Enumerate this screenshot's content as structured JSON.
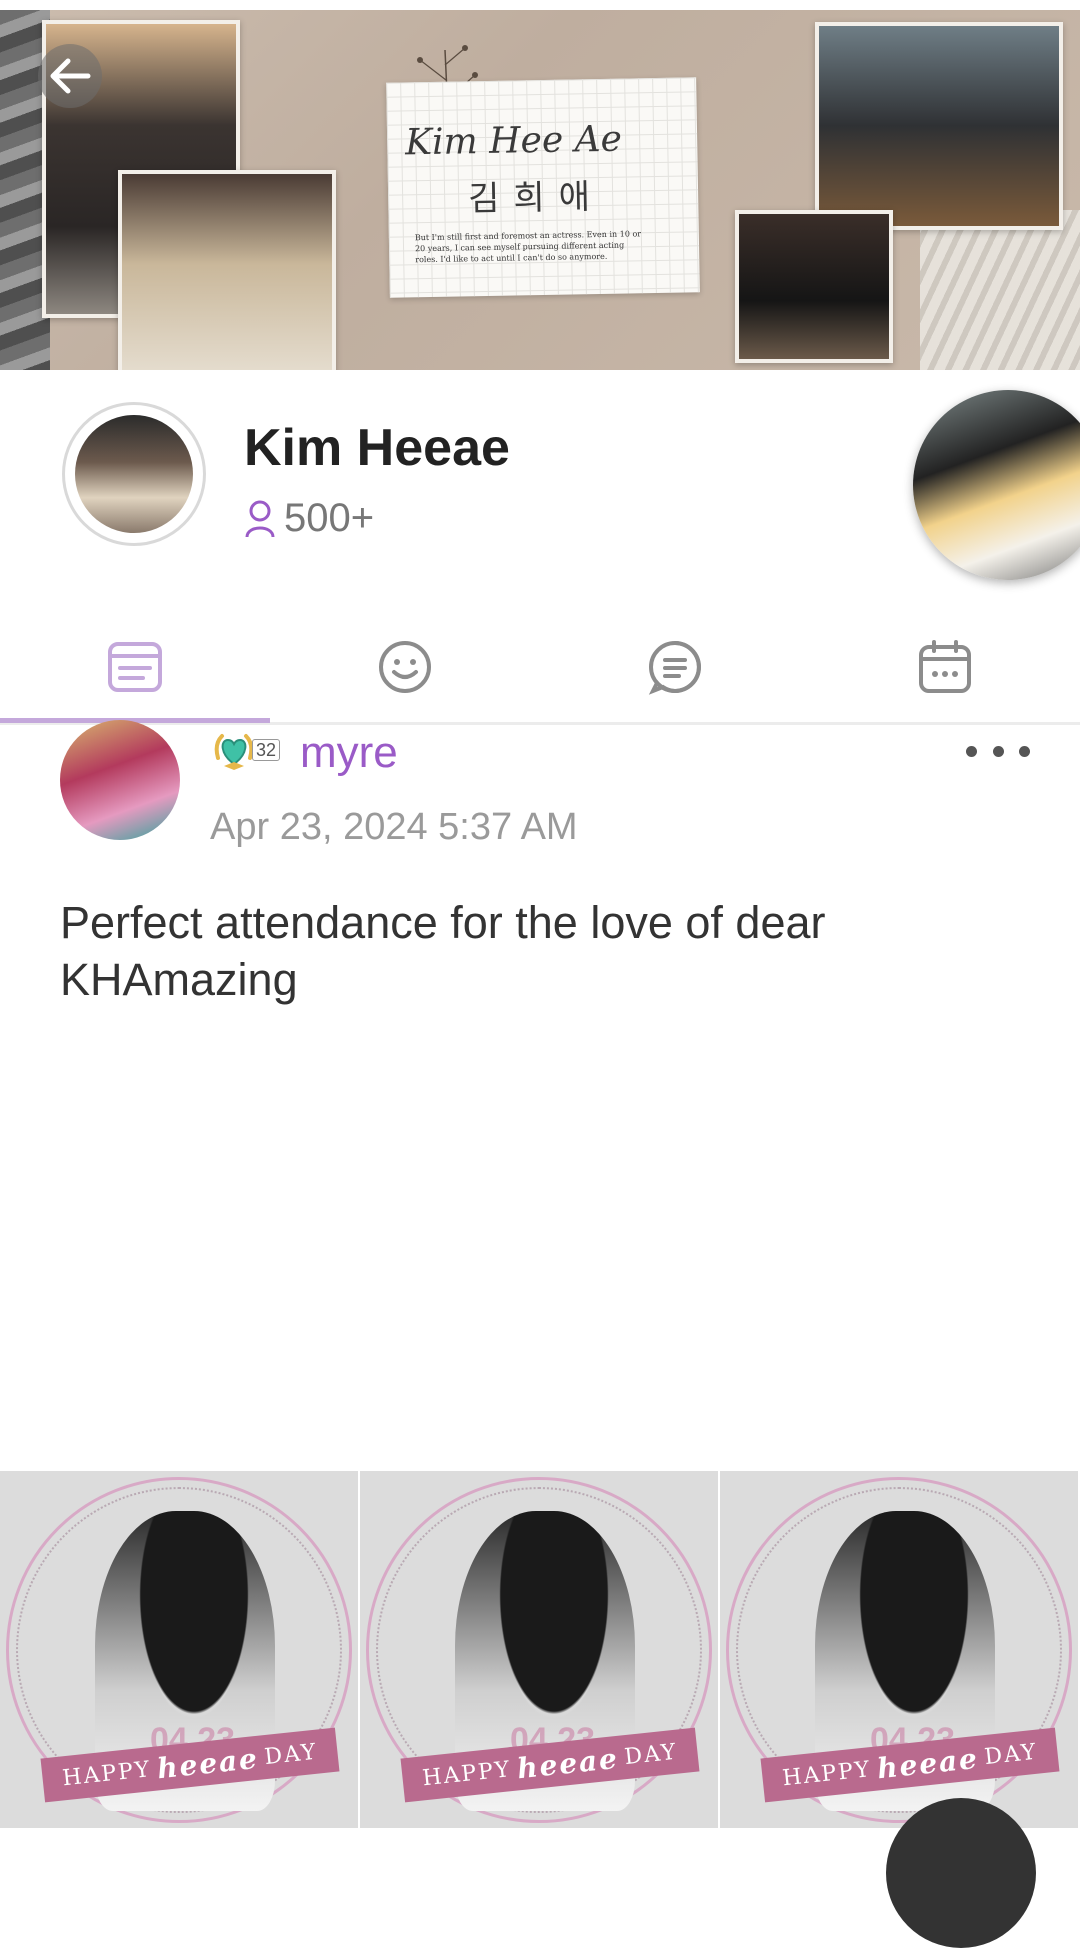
{
  "banner": {
    "signature": "Kim Hee Ae",
    "signature_korean": "김희애",
    "quote": "But I'm still first and foremost an actress. Even in 10 or 20 years, I can see myself pursuing different acting roles. I'd like to act until I can't do so anymore.",
    "back_icon": "arrow-left-icon"
  },
  "community": {
    "name": "Kim Heeae",
    "member_count": "500+",
    "member_icon": "person-icon"
  },
  "tabs": [
    {
      "icon": "feed-icon",
      "active": true
    },
    {
      "icon": "smiley-icon",
      "active": false
    },
    {
      "icon": "chat-bubble-icon",
      "active": false
    },
    {
      "icon": "calendar-icon",
      "active": false
    }
  ],
  "post": {
    "level": "32",
    "username": "myre",
    "timestamp": "Apr 23, 2024 5:37 AM",
    "body": "Perfect attendance for the love of dear KHAmazing"
  },
  "images": [
    {
      "ribbon_left": "HAPPY",
      "ribbon_mid": "heeae",
      "ribbon_right": "DAY",
      "date": "04 23"
    },
    {
      "ribbon_left": "HAPPY",
      "ribbon_mid": "heeae",
      "ribbon_right": "DAY",
      "date": "04 23"
    },
    {
      "ribbon_left": "HAPPY",
      "ribbon_mid": "heeae",
      "ribbon_right": "DAY",
      "date": "04 23"
    }
  ],
  "colors": {
    "accent": "#9a5bc7",
    "tab_active": "#c4a8db",
    "tab_inactive": "#8c8c8c"
  }
}
